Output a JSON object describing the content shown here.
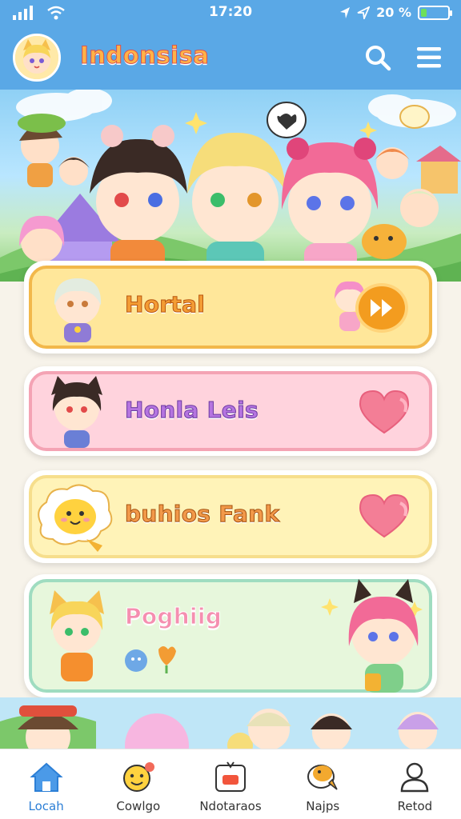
{
  "status_bar": {
    "time": "17:20",
    "battery": "20 %",
    "battery_level": 0.2
  },
  "header": {
    "title": "Indonsisa"
  },
  "cards": [
    {
      "label": "Hortal",
      "bg": "#ffe79a",
      "border": "#f2b84b",
      "text_color": "#f39c34",
      "stroke": "#b8560f",
      "action": "play-icon"
    },
    {
      "label": "Honla Leis",
      "bg": "#ffd3dd",
      "border": "#f4a3b4",
      "text_color": "#b574e0",
      "stroke": "#6b3aa0",
      "action": "heart-icon"
    },
    {
      "label": "buhios Fank",
      "bg": "#fff3b8",
      "border": "#f6de8c",
      "text_color": "#f2994a",
      "stroke": "#a45210",
      "action": "heart-icon"
    },
    {
      "label": "Poghiig",
      "bg": "#e7f7dc",
      "border": "#9fdcc0",
      "text_color": "#f58fb0",
      "stroke": "#ffffff",
      "action": ""
    }
  ],
  "nav": [
    {
      "label": "Locah",
      "icon": "home-icon"
    },
    {
      "label": "Cowlgo",
      "icon": "emoji-icon"
    },
    {
      "label": "Ndotaraos",
      "icon": "inbox-icon"
    },
    {
      "label": "Najps",
      "icon": "chick-icon"
    },
    {
      "label": "Retod",
      "icon": "user-icon"
    }
  ]
}
